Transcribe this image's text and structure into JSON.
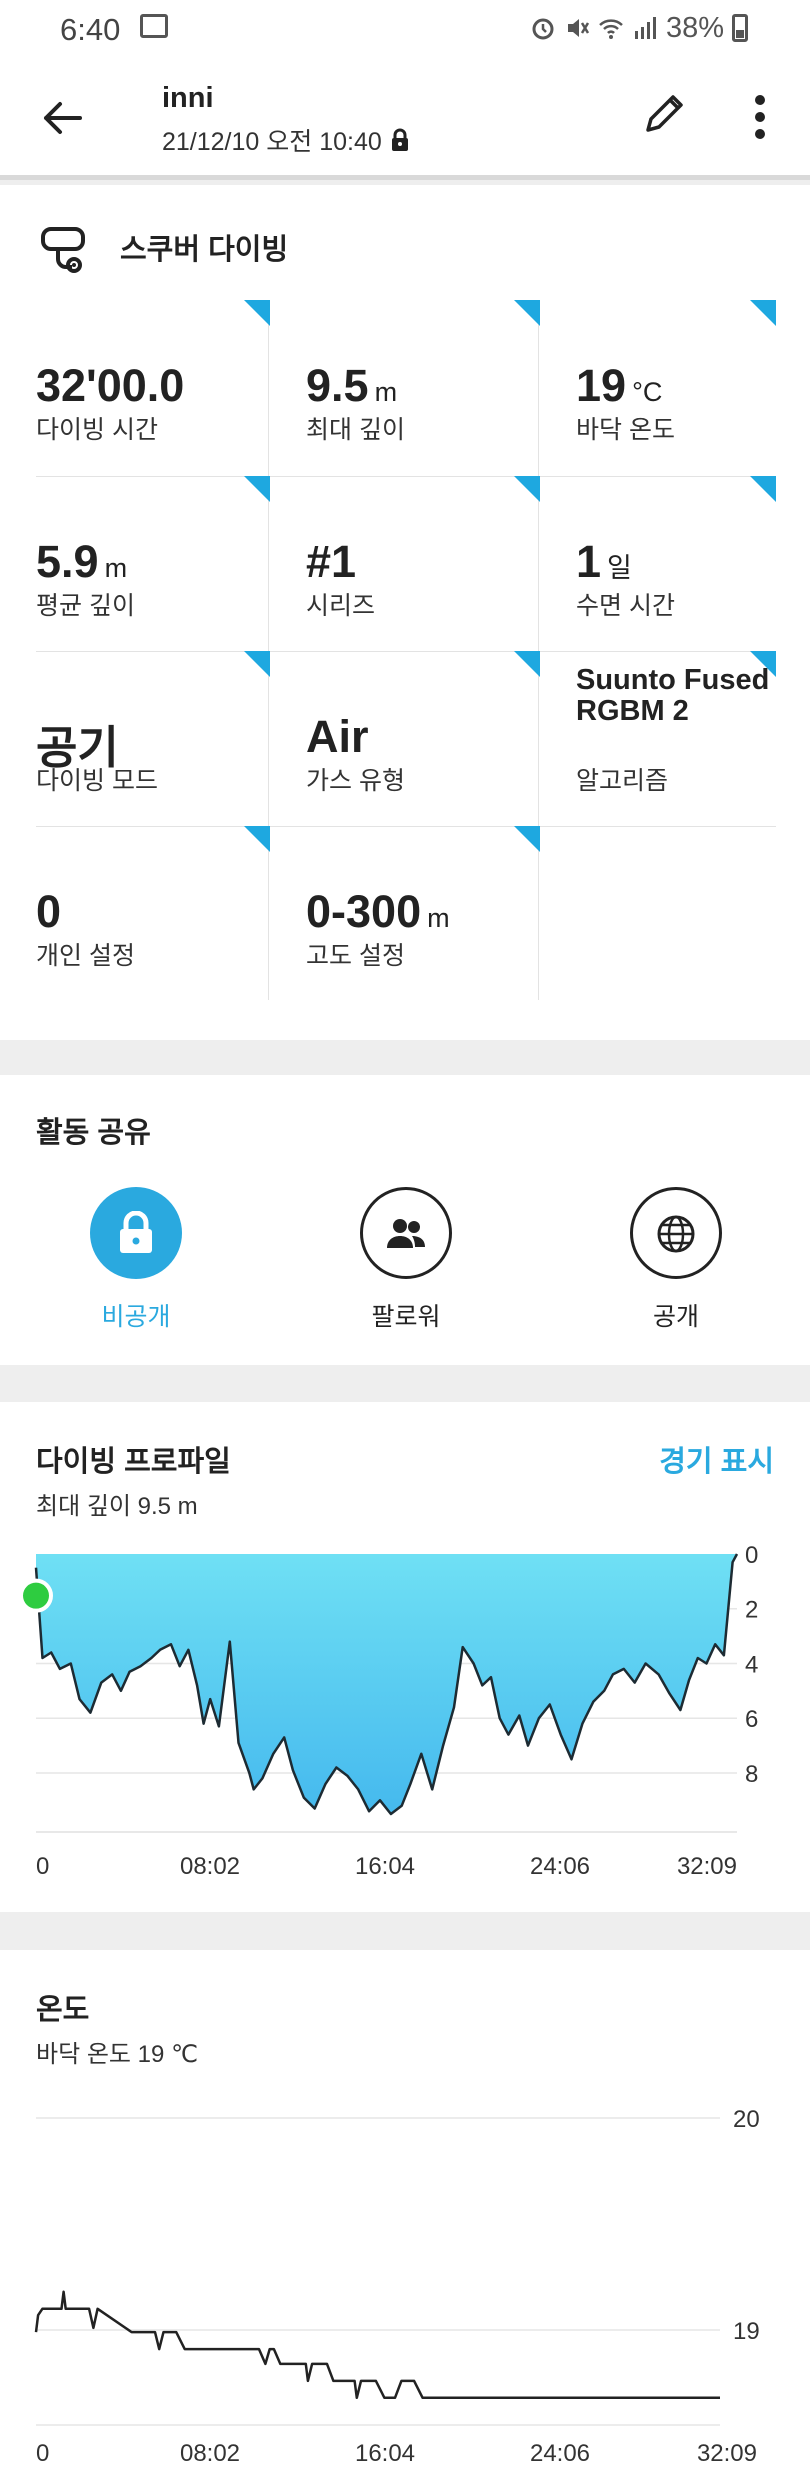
{
  "status_bar": {
    "time": "6:40",
    "battery": "38%",
    "icons": [
      "image-icon",
      "alarm-icon",
      "mute-icon",
      "wifi-icon",
      "signal-icon",
      "battery-icon"
    ]
  },
  "header": {
    "user": "inni",
    "date": "21/12/10 오전 10:40",
    "icons": [
      "back-arrow-icon",
      "lock-icon",
      "edit-pencil-icon",
      "more-vert-icon"
    ]
  },
  "activity": {
    "title": "스쿠버 다이빙",
    "icon": "scuba-mask-icon"
  },
  "stats": [
    {
      "value": "32'00.0",
      "unit": "",
      "label": "다이빙 시간"
    },
    {
      "value": "9.5",
      "unit": "m",
      "label": "최대 깊이"
    },
    {
      "value": "19",
      "unit": "°C",
      "label": "바닥 온도"
    },
    {
      "value": "5.9",
      "unit": "m",
      "label": "평균 깊이"
    },
    {
      "value": "#1",
      "unit": "",
      "label": "시리즈"
    },
    {
      "value": "1",
      "unit": "일",
      "label": "수면 시간"
    },
    {
      "value": "공기",
      "unit": "",
      "label": "다이빙 모드"
    },
    {
      "value": "Air",
      "unit": "",
      "label": "가스 유형"
    },
    {
      "value": "Suunto Fused RGBM 2",
      "unit": "",
      "label": "알고리즘"
    },
    {
      "value": "0",
      "unit": "",
      "label": "개인 설정"
    },
    {
      "value": "0-300",
      "unit": "m",
      "label": "고도 설정"
    }
  ],
  "share": {
    "title": "활동 공유",
    "options": [
      {
        "label": "비공개",
        "icon": "lock-icon",
        "selected": true
      },
      {
        "label": "팔로워",
        "icon": "followers-icon",
        "selected": false
      },
      {
        "label": "공개",
        "icon": "globe-icon",
        "selected": false
      }
    ]
  },
  "profile": {
    "title": "다이빙 프로파일",
    "subtitle": "최대 깊이 9.5 m",
    "link": "경기 표시"
  },
  "temperature": {
    "title": "온도",
    "subtitle": "바닥 온도 19 ℃"
  },
  "colors": {
    "accent": "#2aa9df",
    "corner": "#1ea8e0",
    "depth_fill_top": "#6fe0f4",
    "depth_fill_bottom": "#45b9ee",
    "start_marker": "#2ecc40"
  },
  "chart_data": [
    {
      "type": "area",
      "x": [
        "0",
        "08:02",
        "16:04",
        "24:06",
        "32:09"
      ],
      "yticks": [
        0,
        2,
        4,
        6,
        8
      ],
      "ylim": [
        0,
        9.5
      ],
      "y_inverted": true,
      "series": [
        {
          "times": [
            0.0,
            0.3,
            0.7,
            1.1,
            1.6,
            2.0,
            2.5,
            3.0,
            3.5,
            3.9,
            4.3,
            4.8,
            5.3,
            5.7,
            6.2,
            6.6,
            7.0,
            7.4,
            7.7,
            8.0,
            8.4,
            8.9,
            9.3,
            9.8,
            10.0,
            10.4,
            10.9,
            11.4,
            11.8,
            12.3,
            12.8,
            13.3,
            13.8,
            14.3,
            14.8,
            15.3,
            15.8,
            16.3,
            16.8,
            17.2,
            17.7,
            18.2,
            18.7,
            19.2,
            19.6,
            20.1,
            20.5,
            20.9,
            21.3,
            21.7,
            22.2,
            22.6,
            23.1,
            23.6,
            24.1,
            24.6,
            25.1,
            25.6,
            26.1,
            26.5,
            27.0,
            27.5,
            28.0,
            28.6,
            29.1,
            29.6,
            30.0,
            30.4,
            30.8,
            31.2,
            31.6,
            32.0,
            32.2
          ],
          "depths": [
            0.5,
            3.8,
            3.6,
            4.2,
            4.0,
            5.3,
            5.8,
            4.7,
            4.4,
            5.0,
            4.3,
            4.1,
            3.8,
            3.5,
            3.3,
            4.1,
            3.5,
            4.8,
            6.2,
            5.3,
            6.3,
            3.2,
            6.9,
            8.0,
            8.6,
            8.2,
            7.3,
            6.7,
            7.9,
            8.9,
            9.3,
            8.4,
            7.8,
            8.1,
            8.6,
            9.4,
            9.0,
            9.5,
            9.2,
            8.4,
            7.3,
            8.6,
            7.0,
            5.6,
            3.4,
            4.0,
            4.8,
            4.5,
            6.0,
            6.6,
            5.9,
            7.0,
            6.0,
            5.5,
            6.6,
            7.5,
            6.2,
            5.4,
            5.0,
            4.4,
            4.2,
            4.7,
            4.0,
            4.4,
            5.1,
            5.7,
            4.6,
            3.8,
            4.0,
            3.3,
            3.7,
            0.3,
            0.0
          ]
        }
      ]
    },
    {
      "type": "line",
      "x": [
        "0",
        "08:02",
        "16:04",
        "24:06",
        "32:09"
      ],
      "yticks": [
        19,
        20
      ],
      "ylim": [
        18.55,
        20.0
      ],
      "series": [
        {
          "times": [
            0.0,
            0.1,
            0.3,
            1.2,
            1.3,
            1.4,
            1.5,
            2.0,
            2.5,
            2.7,
            2.9,
            4.5,
            5.3,
            5.6,
            5.8,
            6.0,
            6.2,
            6.4,
            6.6,
            7.0,
            7.6,
            8.0,
            8.3,
            9.0,
            10.5,
            10.8,
            11.0,
            11.2,
            11.5,
            12.0,
            12.7,
            12.8,
            13.0,
            13.7,
            14.0,
            15.0,
            15.1,
            15.3,
            15.4,
            15.7,
            16.0,
            16.4,
            16.9,
            17.2,
            17.5,
            17.8,
            18.2,
            19.0,
            19.6,
            19.8,
            20.0,
            20.4,
            21.0,
            22.0,
            23.0,
            24.0,
            25.0,
            26.0,
            27.0,
            28.0,
            29.0,
            29.6,
            29.8,
            30.0,
            30.5,
            31.0,
            31.5,
            32.0,
            32.2
          ],
          "temps": [
            18.99,
            19.07,
            19.1,
            19.1,
            19.18,
            19.1,
            19.1,
            19.1,
            19.1,
            19.01,
            19.1,
            18.99,
            18.99,
            18.99,
            18.91,
            18.99,
            18.99,
            18.99,
            18.99,
            18.91,
            18.91,
            18.91,
            18.91,
            18.91,
            18.91,
            18.84,
            18.91,
            18.91,
            18.84,
            18.84,
            18.84,
            18.76,
            18.84,
            18.84,
            18.76,
            18.76,
            18.68,
            18.76,
            18.76,
            18.76,
            18.76,
            18.68,
            18.68,
            18.76,
            18.76,
            18.76,
            18.68,
            18.68,
            18.68,
            18.68,
            18.68,
            18.68,
            18.68,
            18.68,
            18.68,
            18.68,
            18.68,
            18.68,
            18.68,
            18.68,
            18.68,
            18.68,
            18.68,
            18.68,
            18.68,
            18.68,
            18.68,
            18.68,
            18.68
          ]
        }
      ]
    }
  ]
}
